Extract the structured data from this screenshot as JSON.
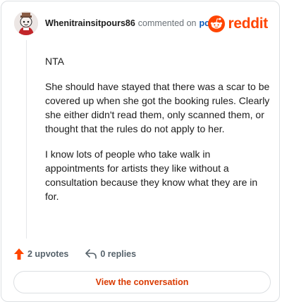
{
  "header": {
    "username": "Whenitrainsitpours86",
    "action_text": "commented on",
    "post_link": "post",
    "brand": "reddit"
  },
  "comment": {
    "paragraphs": [
      "NTA",
      "She should have stayed that there was a scar to be covered up when she got the booking rules. Clearly she either didn't read them, only scanned them, or thought that the rules do not apply to her.",
      "I know lots of people who take walk in appointments for artists they like without a consultation because they know what they are in for."
    ]
  },
  "actions": {
    "upvotes": "2 upvotes",
    "replies": "0 replies"
  },
  "footer": {
    "view_button": "View the conversation"
  },
  "colors": {
    "brand": "#ff4500",
    "link": "#0a58b8",
    "button_text": "#d93a00"
  },
  "icons": [
    "avatar",
    "reddit-logo-icon",
    "upvote-arrow-icon",
    "reply-arrow-icon"
  ]
}
